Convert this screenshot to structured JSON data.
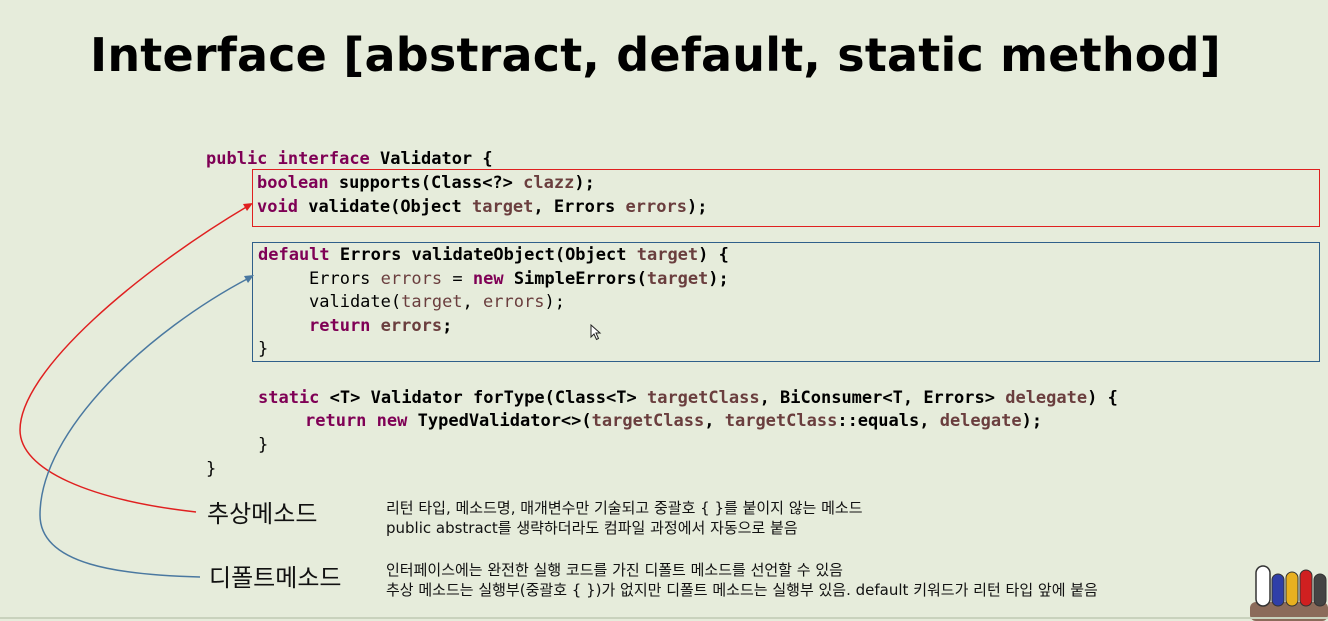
{
  "slide": {
    "title": "Interface [abstract, default, static method]"
  },
  "code": {
    "line1": [
      "public",
      "interface",
      "Validator {"
    ],
    "abstract": {
      "l1": [
        "boolean",
        "supports(Class<?>",
        "clazz",
        ");"
      ],
      "l2": [
        "void",
        "validate(Object",
        "target",
        ", Errors",
        "errors",
        ");"
      ]
    },
    "default_block": {
      "l1": [
        "default",
        "Errors validateObject(Object",
        "target",
        ") {"
      ],
      "l2": [
        "Errors",
        "errors",
        "=",
        "new",
        "SimpleErrors(",
        "target",
        ");"
      ],
      "l3": [
        "validate(",
        "target",
        ", ",
        "errors",
        ");"
      ],
      "l4": [
        "return",
        "errors",
        ";"
      ],
      "l5": "}"
    },
    "static_block": {
      "l1": [
        "static",
        "<T> Validator forType(Class<T>",
        "targetClass",
        ", BiConsumer<T, Errors>",
        "delegate",
        ") {"
      ],
      "l2": [
        "return",
        "new",
        "TypedValidator<>(",
        "targetClass",
        ",",
        "targetClass",
        "::equals,",
        "delegate",
        ");"
      ],
      "l3": "}"
    },
    "closing": "}"
  },
  "annotations": {
    "abstract_label": "추상메소드",
    "abstract_desc_1": "리턴 타입, 메소드명, 매개변수만 기술되고 중괄호 { }를 붙이지 않는 메소드",
    "abstract_desc_2": "public abstract를 생략하더라도 컴파일 과정에서 자동으로 붙음",
    "default_label": "디폴트메소드",
    "default_desc_1": "인터페이스에는 완전한 실행 코드를 가진 디폴트 메소드를 선언할 수 있음",
    "default_desc_2": "추상 메소드는 실행부(중괄호 { })가 없지만 디폴트 메소드는 실행부 있음. default 키워드가 리턴 타입 앞에 붙음"
  },
  "colors": {
    "background": "#e6ecdb",
    "keyword": "#7f0055",
    "variable": "#6a3e3e",
    "abstract_box": "#e02020",
    "default_box": "#2f5f8a"
  }
}
